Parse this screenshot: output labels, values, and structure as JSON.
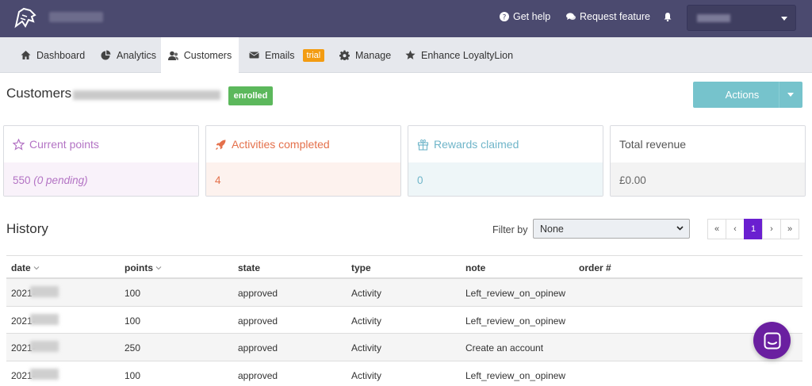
{
  "topbar": {
    "help_label": "Get help",
    "request_label": "Request feature"
  },
  "tabs": [
    {
      "label": "Dashboard",
      "icon": "home-icon"
    },
    {
      "label": "Analytics",
      "icon": "pie-chart-icon"
    },
    {
      "label": "Customers",
      "icon": "users-icon",
      "active": true
    },
    {
      "label": "Emails",
      "icon": "envelope-icon",
      "badge": "trial"
    },
    {
      "label": "Manage",
      "icon": "gear-icon"
    },
    {
      "label": "Enhance LoyaltyLion",
      "icon": "star-icon"
    }
  ],
  "header": {
    "title": "Customers",
    "status_badge": "enrolled",
    "actions_label": "Actions"
  },
  "stats": [
    {
      "label": "Current points",
      "value": "550",
      "pending": "(0 pending)",
      "icon": "star-outline-icon",
      "color": "#b373c4"
    },
    {
      "label": "Activities completed",
      "value": "4",
      "icon": "rocket-icon",
      "color": "#e4704b"
    },
    {
      "label": "Rewards claimed",
      "value": "0",
      "icon": "gift-icon",
      "color": "#6fb5c9"
    },
    {
      "label": "Total revenue",
      "value": "£0.00"
    }
  ],
  "history": {
    "title": "History",
    "filter_label": "Filter by",
    "filter_value": "None",
    "pagination": [
      "«",
      "‹",
      "1",
      "›",
      "»"
    ],
    "current_page": "1",
    "columns": [
      "date",
      "points",
      "state",
      "type",
      "note",
      "order #"
    ],
    "rows": [
      {
        "date": "2021-",
        "points": "100",
        "state": "approved",
        "type": "Activity",
        "note": "Left_review_on_opinew"
      },
      {
        "date": "2021-",
        "points": "100",
        "state": "approved",
        "type": "Activity",
        "note": "Left_review_on_opinew"
      },
      {
        "date": "2021-",
        "points": "250",
        "state": "approved",
        "type": "Activity",
        "note": "Create an account"
      },
      {
        "date": "2021-",
        "points": "100",
        "state": "approved",
        "type": "Activity",
        "note": "Left_review_on_opinew"
      }
    ]
  },
  "colors": {
    "topbar": "#4b4a6f",
    "accent_purple": "#6a1fd0",
    "actions_button": "#76c3cc",
    "enrolled_badge": "#5cb85c",
    "trial_badge": "#f39c12"
  }
}
